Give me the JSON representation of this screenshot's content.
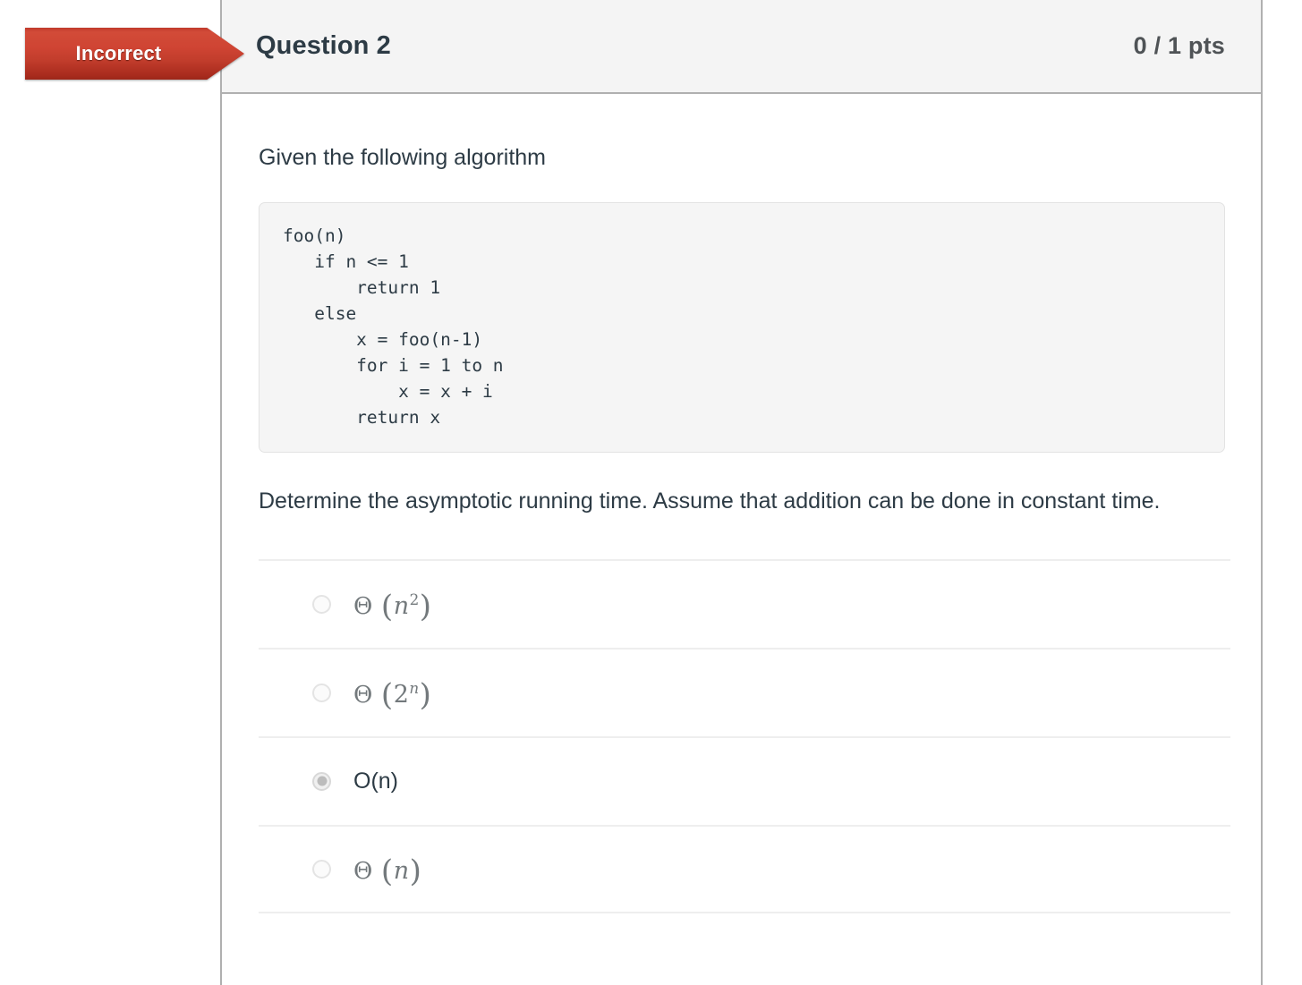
{
  "status_banner": {
    "label": "Incorrect",
    "color": "#c0392b"
  },
  "header": {
    "title": "Question 2",
    "points": "0 / 1 pts"
  },
  "body": {
    "prompt": "Given the following algorithm",
    "code": "foo(n)\n   if n <= 1\n       return 1\n   else\n       x = foo(n-1)\n       for i = 1 to n\n           x = x + i\n       return x",
    "instruction": " Determine the asymptotic running time.  Assume that addition can be done in constant time."
  },
  "answers": [
    {
      "text": "Θ (n²)",
      "render": "math",
      "theta": "Θ",
      "open_paren": "(",
      "base": "n",
      "exponent": "2",
      "exponent_italic": false,
      "close_paren": ")",
      "selected": false
    },
    {
      "text": "Θ (2ⁿ)",
      "render": "math",
      "theta": "Θ",
      "open_paren": "(",
      "base": "2",
      "exponent": "n",
      "exponent_italic": true,
      "close_paren": ")",
      "selected": false
    },
    {
      "text": "O(n)",
      "render": "plain",
      "selected": true
    },
    {
      "text": "Θ (n)",
      "render": "math",
      "theta": "Θ",
      "open_paren": "(",
      "base": "n",
      "exponent": "",
      "exponent_italic": false,
      "close_paren": ")",
      "selected": false
    }
  ]
}
